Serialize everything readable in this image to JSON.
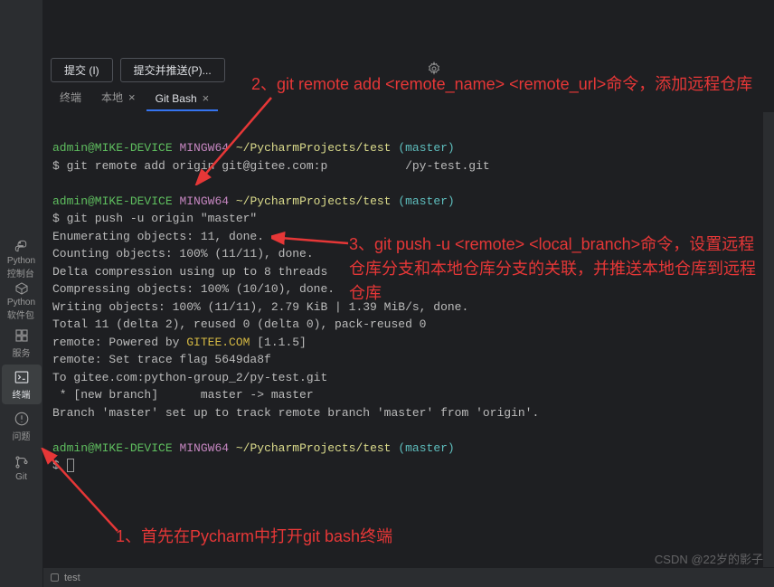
{
  "activity": {
    "items": [
      {
        "label": "Python\n控制台"
      },
      {
        "label": "Python\n软件包"
      },
      {
        "label": "服务"
      },
      {
        "label": "终端"
      },
      {
        "label": "问题"
      },
      {
        "label": "Git"
      }
    ]
  },
  "buttons": {
    "commit": "提交 (I)",
    "commit_push": "提交并推送(P)..."
  },
  "tabs": {
    "items": [
      {
        "label": "终端",
        "closable": false
      },
      {
        "label": "本地",
        "closable": true
      },
      {
        "label": "Git Bash",
        "closable": true,
        "active": true
      }
    ]
  },
  "terminal": {
    "prompt1_user": "admin@MIKE-DEVICE",
    "prompt1_sys": "MINGW64",
    "prompt1_path": "~/PycharmProjects/test",
    "prompt1_branch": "(master)",
    "cmd1": "$ git remote add origin git@gitee.com:p           /py-test.git",
    "prompt2_user": "admin@MIKE-DEVICE",
    "prompt2_sys": "MINGW64",
    "prompt2_path": "~/PycharmProjects/test",
    "prompt2_branch": "(master)",
    "cmd2": "$ git push -u origin \"master\"",
    "out1": "Enumerating objects: 11, done.",
    "out2": "Counting objects: 100% (11/11), done.",
    "out3": "Delta compression using up to 8 threads",
    "out4": "Compressing objects: 100% (10/10), done.",
    "out5": "Writing objects: 100% (11/11), 2.79 KiB | 1.39 MiB/s, done.",
    "out6": "Total 11 (delta 2), reused 0 (delta 0), pack-reused 0",
    "out7a": "remote: Powered by ",
    "out7b": "GITEE.COM",
    "out7c": " [1.1.5]",
    "out8": "remote: Set trace flag 5649da8f",
    "out9": "To gitee.com:python-group_2/py-test.git",
    "out10": " * [new branch]      master -> master",
    "out11": "Branch 'master' set up to track remote branch 'master' from 'origin'.",
    "prompt3_user": "admin@MIKE-DEVICE",
    "prompt3_sys": "MINGW64",
    "prompt3_path": "~/PycharmProjects/test",
    "prompt3_branch": "(master)",
    "cmd3": "$ "
  },
  "status": {
    "project": "test"
  },
  "watermark": "CSDN @22岁的影子",
  "annotations": {
    "a1": "1、首先在Pycharm中打开git bash终端",
    "a2": "2、git remote add <remote_name> <remote_url>命令，添加远程仓库",
    "a3": "3、git push -u <remote> <local_branch>命令，设置远程仓库分支和本地仓库分支的关联，并推送本地仓库到远程仓库"
  }
}
